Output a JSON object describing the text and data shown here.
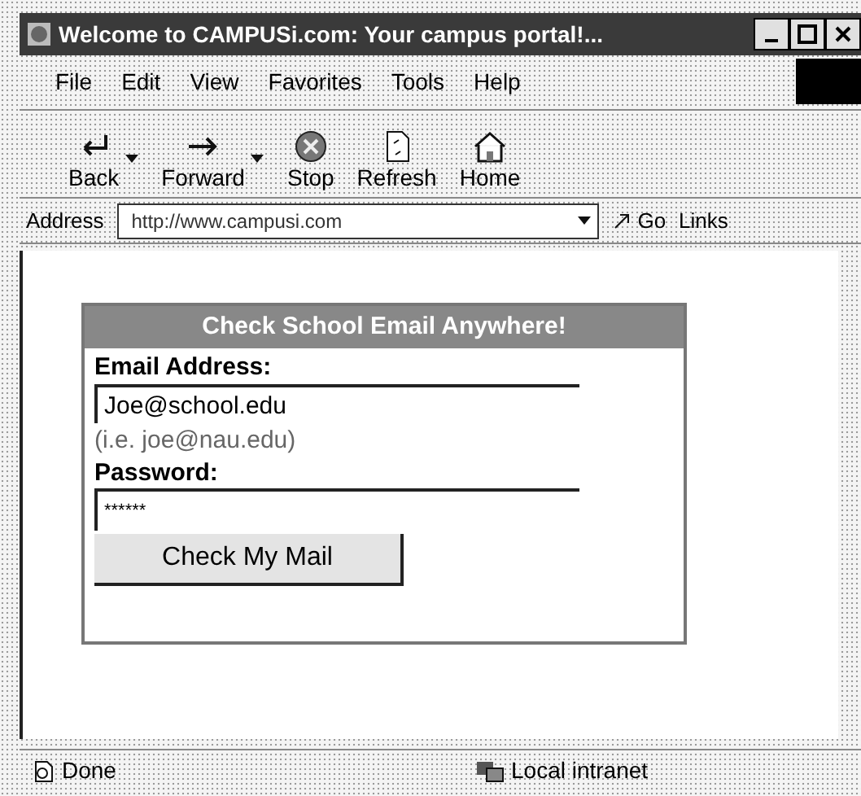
{
  "window": {
    "title": "Welcome to CAMPUSi.com: Your campus portal!..."
  },
  "menu": [
    "File",
    "Edit",
    "View",
    "Favorites",
    "Tools",
    "Help"
  ],
  "toolbar": [
    {
      "label": "Back",
      "kind": "back",
      "dropdown": true
    },
    {
      "label": "Forward",
      "kind": "forward",
      "dropdown": true
    },
    {
      "label": "Stop",
      "kind": "stop",
      "dropdown": false
    },
    {
      "label": "Refresh",
      "kind": "refresh",
      "dropdown": false
    },
    {
      "label": "Home",
      "kind": "home",
      "dropdown": false
    }
  ],
  "address_bar": {
    "label": "Address",
    "value": "http://www.campusi.com",
    "go": "Go",
    "links": "Links"
  },
  "login_box": {
    "title": "Check School Email Anywhere!",
    "email_label": "Email Address:",
    "email_value": "Joe@school.edu",
    "email_hint": "(i.e. joe@nau.edu)",
    "password_label": "Password:",
    "password_value": "******",
    "submit": "Check My Mail"
  },
  "status_bar": {
    "status": "Done",
    "zone": "Local intranet"
  }
}
